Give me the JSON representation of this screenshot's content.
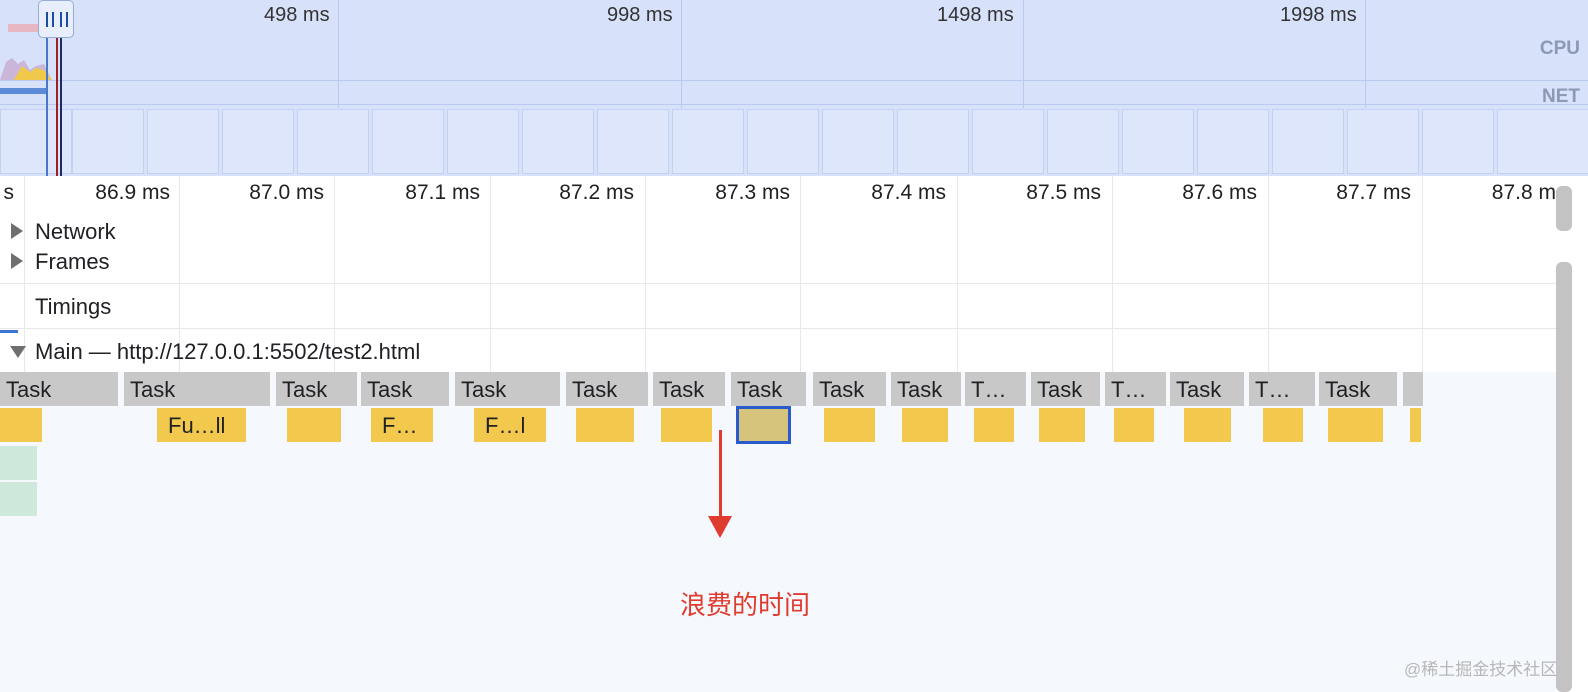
{
  "overview": {
    "ticks": [
      "498 ms",
      "998 ms",
      "1498 ms",
      "1998 ms"
    ],
    "cpu_label": "CPU",
    "net_label": "NET"
  },
  "ruler": {
    "ticks": [
      "s",
      "86.9 ms",
      "87.0 ms",
      "87.1 ms",
      "87.2 ms",
      "87.3 ms",
      "87.4 ms",
      "87.5 ms",
      "87.6 ms",
      "87.7 ms",
      "87.8 m"
    ]
  },
  "tracks": {
    "network": "Network",
    "frames": "Frames",
    "timings": "Timings",
    "main": "Main — http://127.0.0.1:5502/test2.html"
  },
  "flame": {
    "tasks": [
      "Task",
      "Task",
      "Task",
      "Task",
      "Task",
      "Task",
      "Task",
      "Task",
      "Task",
      "Task",
      "T…",
      "Task",
      "T…",
      "Task",
      "T…",
      "Task",
      ""
    ],
    "functions": [
      "",
      "Fu…ll",
      "",
      "F…",
      "F…l",
      "",
      "",
      "",
      "",
      "",
      "",
      "",
      "",
      "",
      "",
      "",
      ""
    ]
  },
  "annotation": {
    "text": "浪费的时间"
  },
  "watermark": "@稀土掘金技术社区",
  "colors": {
    "task": "#c8c8c8",
    "function": "#f2c94c",
    "selected_function": "#d7c47c",
    "selection_border": "#2a5bcc",
    "annotation": "#e03b2f",
    "overview_bg": "#d7e2fa"
  }
}
